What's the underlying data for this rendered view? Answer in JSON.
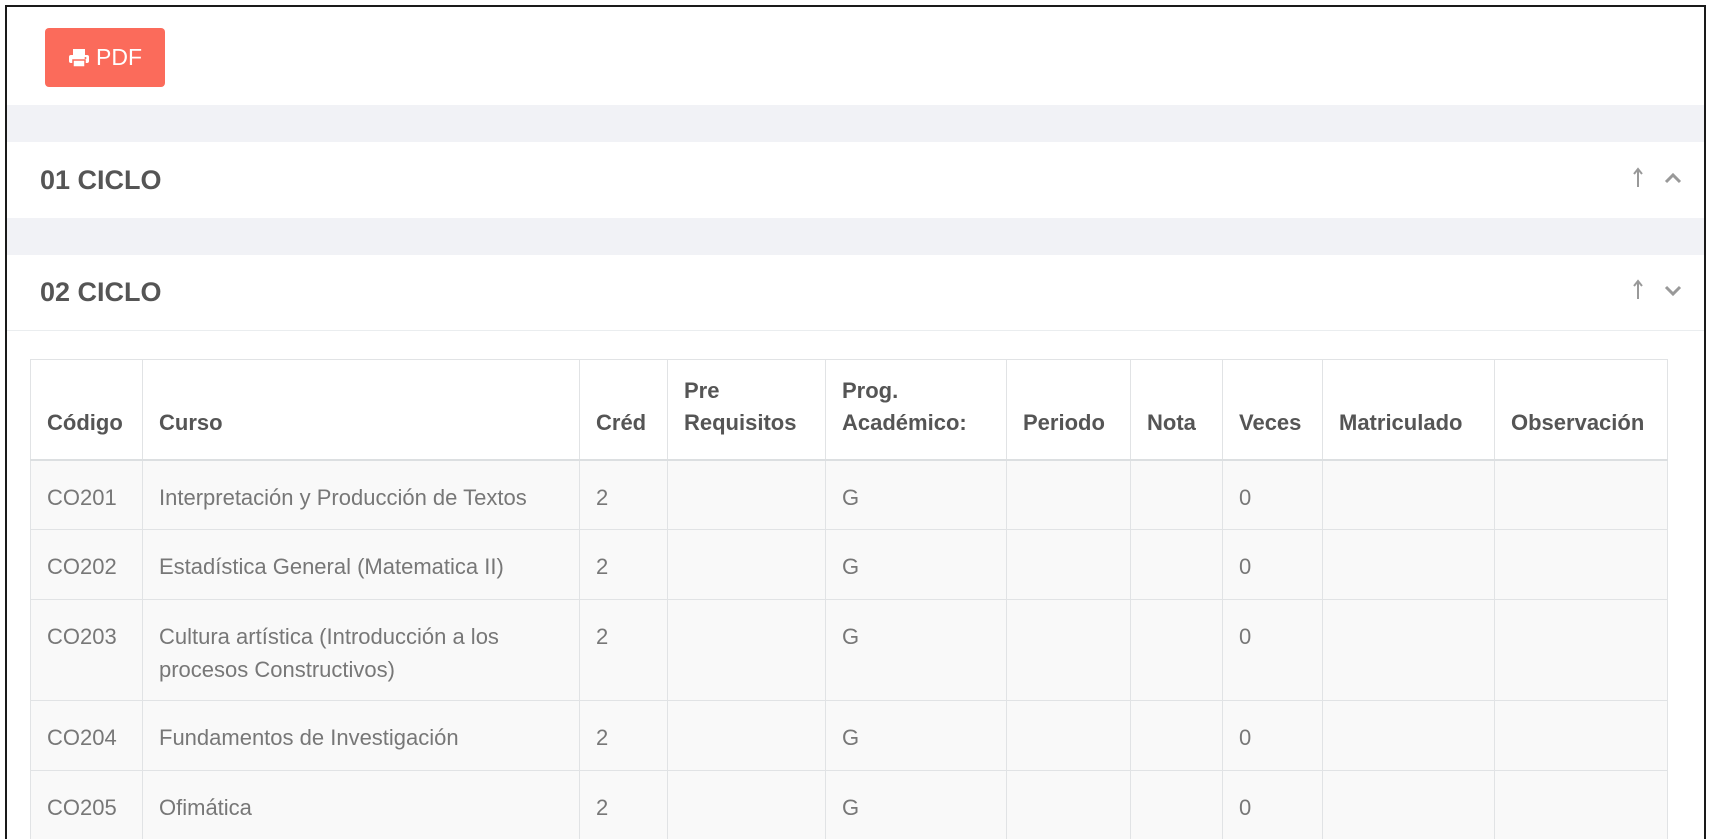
{
  "toolbar": {
    "pdf_label": "PDF",
    "pdf_icon": "print-icon",
    "pdf_color": "#fb6b5b"
  },
  "cycles": [
    {
      "title": "01 CICLO",
      "state": "collapsed",
      "icons": [
        "arrow-up-icon",
        "chevron-up-icon"
      ]
    },
    {
      "title": "02 CICLO",
      "state": "expanded",
      "icons": [
        "arrow-up-icon",
        "chevron-down-icon"
      ]
    }
  ],
  "table": {
    "headers": {
      "codigo": "Código",
      "curso": "Curso",
      "cred": "Créd",
      "prereq_1": "Pre",
      "prereq_2": "Requisitos",
      "prog_1": "Prog.",
      "prog_2": "Académico:",
      "periodo": "Periodo",
      "nota": "Nota",
      "veces": "Veces",
      "matriculado": "Matriculado",
      "observacion": "Observación"
    },
    "rows": [
      {
        "codigo": "CO201",
        "curso": "Interpretación y Producción de Textos",
        "cred": "2",
        "prereq": "",
        "prog": "G",
        "periodo": "",
        "nota": "",
        "veces": "0",
        "matriculado": "",
        "observacion": ""
      },
      {
        "codigo": "CO202",
        "curso": "Estadística General (Matematica II)",
        "cred": "2",
        "prereq": "",
        "prog": "G",
        "periodo": "",
        "nota": "",
        "veces": "0",
        "matriculado": "",
        "observacion": ""
      },
      {
        "codigo": "CO203",
        "curso": "Cultura artística (Introducción a los procesos Constructivos)",
        "cred": "2",
        "prereq": "",
        "prog": "G",
        "periodo": "",
        "nota": "",
        "veces": "0",
        "matriculado": "",
        "observacion": ""
      },
      {
        "codigo": "CO204",
        "curso": "Fundamentos de Investigación",
        "cred": "2",
        "prereq": "",
        "prog": "G",
        "periodo": "",
        "nota": "",
        "veces": "0",
        "matriculado": "",
        "observacion": ""
      },
      {
        "codigo": "CO205",
        "curso": "Ofimática",
        "cred": "2",
        "prereq": "",
        "prog": "G",
        "periodo": "",
        "nota": "",
        "veces": "0",
        "matriculado": "",
        "observacion": ""
      }
    ]
  }
}
